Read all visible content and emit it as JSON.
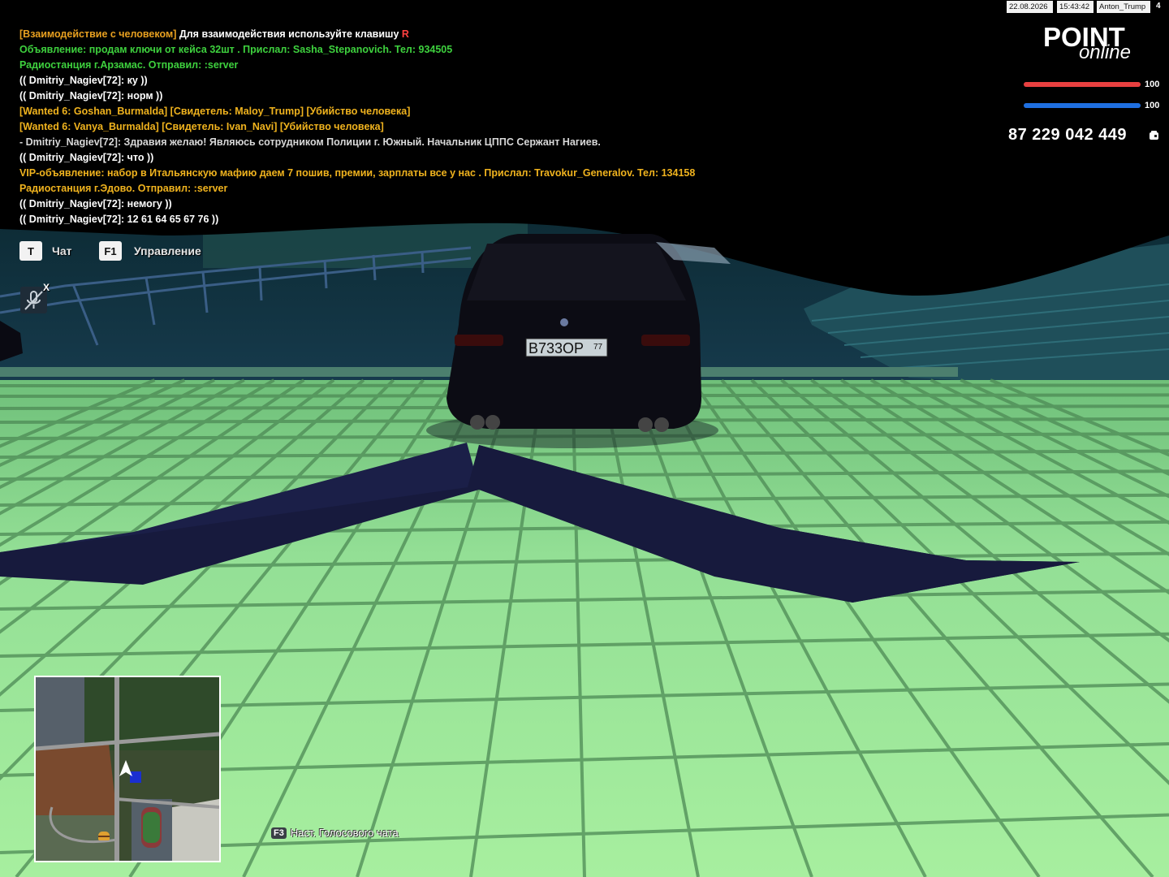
{
  "server_info": {
    "date": "22.08.2026",
    "time": "15:43:42",
    "player_name": "Anton_Trump",
    "player_id": "4"
  },
  "logo": {
    "line1": "POINT",
    "line2": "online"
  },
  "stats": {
    "health": 100,
    "health_label": "100",
    "armor": 100,
    "armor_label": "100",
    "money": "87 229 042 449",
    "health_color": "#e84040",
    "armor_color": "#1f6fe0"
  },
  "chat": [
    {
      "text": "[Взаимодействие с человеком] Для взаимодействия используйте клавишу R",
      "color": "#e6c229",
      "prefix": "[Взаимодействие с человеком]",
      "prefix_color": "#e8a020",
      "body": " Для взаимодействия используйте клавишу ",
      "body_color": "#ffffff",
      "key": "R",
      "key_color": "#ff4040"
    },
    {
      "text": "Объявление: продам ключи от кейса 32шт . Прислал: Sasha_Stepanovich. Тел: 934505",
      "color": "#3ed13e"
    },
    {
      "text": "Радиостанция г.Арзамас. Отправил: :server",
      "color": "#3ed13e"
    },
    {
      "text": "(( Dmitriy_Nagiev[72]: ку ))",
      "color": "#ffffff"
    },
    {
      "text": "(( Dmitriy_Nagiev[72]: норм ))",
      "color": "#ffffff"
    },
    {
      "text": "[Wanted 6: Goshan_Burmalda] [Свидетель: Maloy_Trump] [Убийство человека]",
      "color": "#f0b31e"
    },
    {
      "text": "[Wanted 6: Vanya_Burmalda] [Свидетель: Ivan_Navi] [Убийство человека]",
      "color": "#f0b31e"
    },
    {
      "text": "- Dmitriy_Nagiev[72]: Здравия желаю! Являюсь сотрудником Полиции г. Южный. Начальник ЦППС Сержант Нагиев.",
      "color": "#d8d8d8"
    },
    {
      "text": "(( Dmitriy_Nagiev[72]: что ))",
      "color": "#ffffff"
    },
    {
      "text": "VIP-объявление: набор в Итальянскую мафию даем 7 пошив, премии, зарплаты все у нас . Прислал: Travokur_Generalov. Тел: 134158",
      "color": "#f0b31e"
    },
    {
      "text": "Радиостанция г.Эдово. Отправил: :server",
      "color": "#f0b31e"
    },
    {
      "text": "(( Dmitriy_Nagiev[72]: немогу ))",
      "color": "#ffffff"
    },
    {
      "text": "(( Dmitriy_Nagiev[72]: 12 61 64 65 67 76 ))",
      "color": "#ffffff"
    }
  ],
  "hints": {
    "chat_key": "T",
    "chat_label": "Чат",
    "control_key": "F1",
    "control_label": "Управление",
    "mic_close": "X",
    "voice_key": "F3",
    "voice_label": "Наст. Голосового чата"
  },
  "vehicle": {
    "plate_number": "В733ОР",
    "plate_region": "77"
  },
  "colors": {
    "ground": "#9ee89a",
    "grout": "#4f8f4f",
    "shadow": "#1a1f45"
  }
}
